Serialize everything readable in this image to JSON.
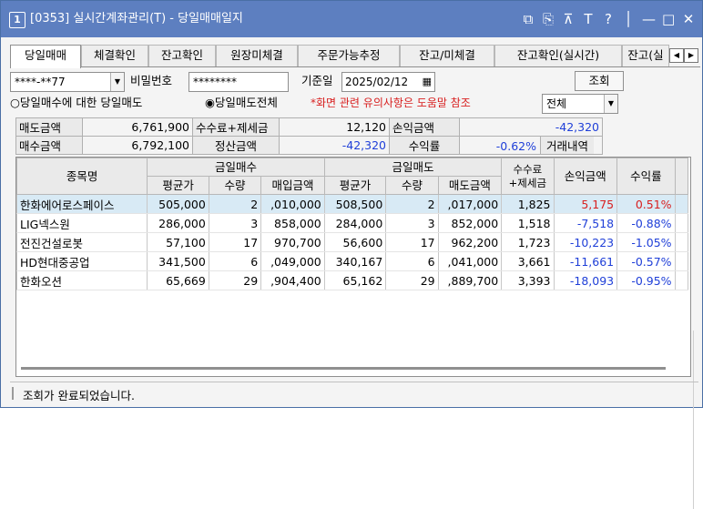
{
  "window": {
    "number": "1",
    "title": "[0353] 실시간계좌관리(T) - 당일매매일지",
    "controls": [
      "⧉",
      "⎘",
      "⊼",
      "T",
      "?",
      "│",
      "—",
      "□",
      "✕"
    ]
  },
  "tabs": [
    "당일매매",
    "체결확인",
    "잔고확인",
    "원장미체결",
    "주문가능추정",
    "잔고/미체결",
    "잔고확인(실시간)",
    "잔고(실"
  ],
  "toolbar": {
    "account": "****-**77",
    "password_label": "비밀번호",
    "password": "********",
    "date_label": "기준일",
    "date": "2025/02/12",
    "query_button": "조회",
    "radio1": "당일매수에 대한 당일매도",
    "radio2": "당일매도전체",
    "notice": "*화면 관련 유의사항은 도움말 참조",
    "filter": "전체"
  },
  "summary": {
    "sell_amount_label": "매도금액",
    "sell_amount": "6,761,900",
    "fee_label": "수수료+제세금",
    "fee": "12,120",
    "pnl_label": "손익금액",
    "pnl": "-42,320",
    "buy_amount_label": "매수금액",
    "buy_amount": "6,792,100",
    "settle_label": "정산금액",
    "settle": "-42,320",
    "return_label": "수익률",
    "return": "-0.62%",
    "history_label": "거래내역"
  },
  "grid": {
    "headers": {
      "name": "종목명",
      "buy_group": "금일매수",
      "sell_group": "금일매도",
      "avg_price": "평균가",
      "qty": "수량",
      "buy_amount": "매입금액",
      "sell_amount": "매도금액",
      "fee": "수수료\n+제세금",
      "pnl": "손익금액",
      "return": "수익률"
    },
    "rows": [
      {
        "name": "한화에어로스페이스",
        "buy_avg": "505,000",
        "buy_qty": "2",
        "buy_amt": ",010,000",
        "sell_avg": "508,500",
        "sell_qty": "2",
        "sell_amt": ",017,000",
        "fee": "1,825",
        "pnl": "5,175",
        "ret": "0.51%",
        "sign": "pos"
      },
      {
        "name": "LIG넥스원",
        "buy_avg": "286,000",
        "buy_qty": "3",
        "buy_amt": "858,000",
        "sell_avg": "284,000",
        "sell_qty": "3",
        "sell_amt": "852,000",
        "fee": "1,518",
        "pnl": "-7,518",
        "ret": "-0.88%",
        "sign": "neg"
      },
      {
        "name": "전진건설로봇",
        "buy_avg": "57,100",
        "buy_qty": "17",
        "buy_amt": "970,700",
        "sell_avg": "56,600",
        "sell_qty": "17",
        "sell_amt": "962,200",
        "fee": "1,723",
        "pnl": "-10,223",
        "ret": "-1.05%",
        "sign": "neg"
      },
      {
        "name": "HD현대중공업",
        "buy_avg": "341,500",
        "buy_qty": "6",
        "buy_amt": ",049,000",
        "sell_avg": "340,167",
        "sell_qty": "6",
        "sell_amt": ",041,000",
        "fee": "3,661",
        "pnl": "-11,661",
        "ret": "-0.57%",
        "sign": "neg"
      },
      {
        "name": "한화오션",
        "buy_avg": "65,669",
        "buy_qty": "29",
        "buy_amt": ",904,400",
        "sell_avg": "65,162",
        "sell_qty": "29",
        "sell_amt": ",889,700",
        "fee": "3,393",
        "pnl": "-18,093",
        "ret": "-0.95%",
        "sign": "neg"
      }
    ]
  },
  "status": "조회가 완료되었습니다.",
  "colors": {
    "title_bar": "#5d7fc0",
    "negative": "#1f3fd8",
    "positive": "#d81f1f",
    "notice": "#d81f1f",
    "selected_row": "#d8eaf5"
  }
}
